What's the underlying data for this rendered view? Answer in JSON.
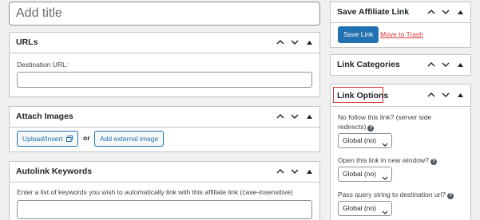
{
  "title_placeholder": "Add title",
  "urls": {
    "title": "URLs",
    "destination_label": "Destination URL:",
    "destination_value": ""
  },
  "attach_images": {
    "title": "Attach Images",
    "upload_label": "Upload/Insert",
    "or_text": "or",
    "external_label": "Add external image"
  },
  "autolink": {
    "title": "Autolink Keywords",
    "description": "Enter a list of keywords you wish to automatically link with this affiliate link (case-insensitive)"
  },
  "save_box": {
    "title": "Save Affiliate Link",
    "save_label": "Save Link",
    "trash_label": "Move to Trash"
  },
  "categories": {
    "title": "Link Categories"
  },
  "link_options": {
    "title": "Link Options",
    "nofollow_label_line1": "No follow this link? (server side",
    "nofollow_label_line2": "redirects)",
    "nofollow_value": "Global (no)",
    "newwindow_label": "Open this link in new window?",
    "newwindow_value": "Global (no)",
    "passquery_label": "Pass query string to destination url?",
    "passquery_value": "Global (no)",
    "help_glyph": "?"
  },
  "colors": {
    "accent": "#2271b1",
    "danger": "#d63638",
    "highlight_border": "#d63638",
    "background": "#f0f0f1"
  },
  "icons": {
    "move_up": "chevron-up-icon",
    "move_down": "chevron-down-icon",
    "toggle": "triangle-up-icon",
    "media": "media-icon",
    "help": "help-icon"
  }
}
